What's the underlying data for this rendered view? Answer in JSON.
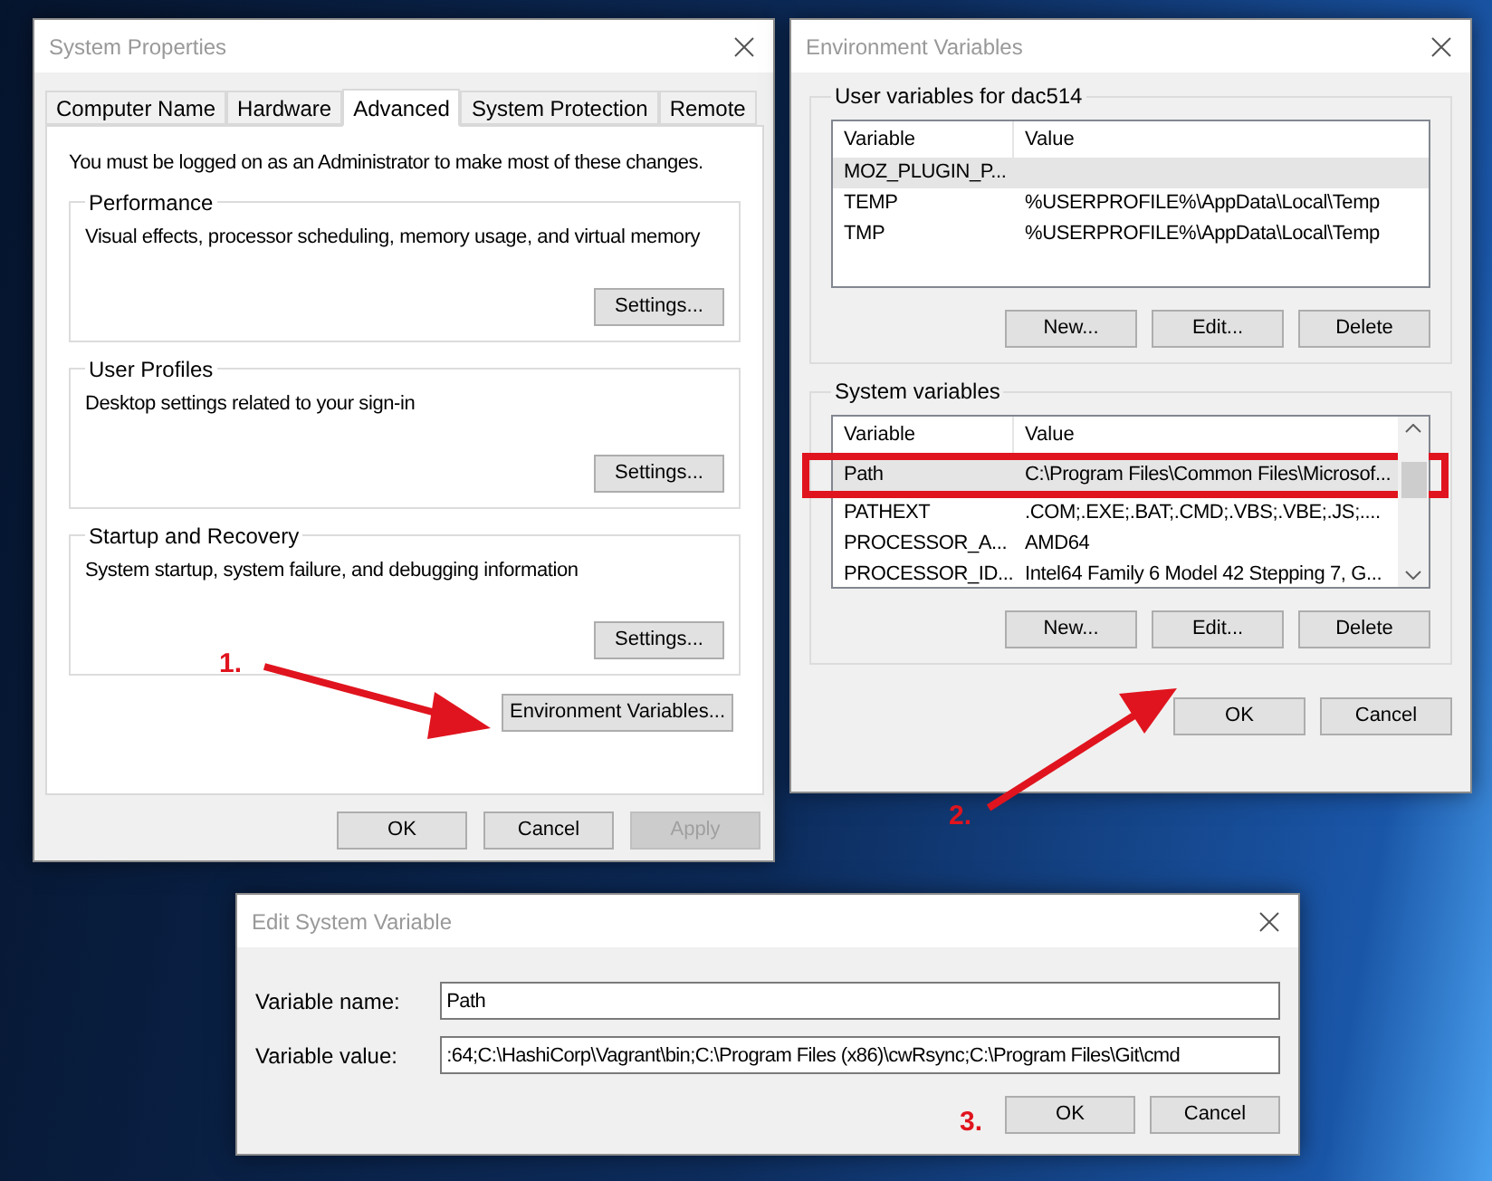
{
  "system_properties": {
    "title": "System Properties",
    "tabs": [
      {
        "label": "Computer Name",
        "selected": false
      },
      {
        "label": "Hardware",
        "selected": false
      },
      {
        "label": "Advanced",
        "selected": true
      },
      {
        "label": "System Protection",
        "selected": false
      },
      {
        "label": "Remote",
        "selected": false
      }
    ],
    "notice": "You must be logged on as an Administrator to make most of these changes.",
    "groups": [
      {
        "title": "Performance",
        "description": "Visual effects, processor scheduling, memory usage, and virtual memory",
        "button": "Settings..."
      },
      {
        "title": "User Profiles",
        "description": "Desktop settings related to your sign-in",
        "button": "Settings..."
      },
      {
        "title": "Startup and Recovery",
        "description": "System startup, system failure, and debugging information",
        "button": "Settings..."
      }
    ],
    "env_button": "Environment Variables...",
    "buttons": [
      {
        "label": "OK",
        "disabled": false
      },
      {
        "label": "Cancel",
        "disabled": false
      },
      {
        "label": "Apply",
        "disabled": true
      }
    ]
  },
  "environment_variables": {
    "title": "Environment Variables",
    "sections": [
      {
        "title": "User variables for dac514",
        "columns": [
          "Variable",
          "Value"
        ],
        "rows": [
          {
            "variable": "MOZ_PLUGIN_P...",
            "value": "",
            "selected": true,
            "highlighted": false
          },
          {
            "variable": "TEMP",
            "value": "%USERPROFILE%\\AppData\\Local\\Temp",
            "selected": false,
            "highlighted": false
          },
          {
            "variable": "TMP",
            "value": "%USERPROFILE%\\AppData\\Local\\Temp",
            "selected": false,
            "highlighted": false
          }
        ],
        "buttons": [
          "New...",
          "Edit...",
          "Delete"
        ]
      },
      {
        "title": "System variables",
        "columns": [
          "Variable",
          "Value"
        ],
        "rows": [
          {
            "variable": "Path",
            "value": "C:\\Program Files\\Common Files\\Microsof...",
            "selected": true,
            "highlighted": true
          },
          {
            "variable": "PATHEXT",
            "value": ".COM;.EXE;.BAT;.CMD;.VBS;.VBE;.JS;....",
            "selected": false,
            "highlighted": false
          },
          {
            "variable": "PROCESSOR_A...",
            "value": "AMD64",
            "selected": false,
            "highlighted": false
          },
          {
            "variable": "PROCESSOR_ID...",
            "value": "Intel64 Family 6 Model 42 Stepping 7, G...",
            "selected": false,
            "highlighted": false
          }
        ],
        "buttons": [
          "New...",
          "Edit...",
          "Delete"
        ]
      }
    ],
    "buttons": [
      "OK",
      "Cancel"
    ]
  },
  "edit_system_variable": {
    "title": "Edit System Variable",
    "fields": [
      {
        "label": "Variable name:",
        "value": "Path"
      },
      {
        "label": "Variable value:",
        "value": ":64;C:\\HashiCorp\\Vagrant\\bin;C:\\Program Files (x86)\\cwRsync;C:\\Program Files\\Git\\cmd"
      }
    ],
    "buttons": [
      "OK",
      "Cancel"
    ]
  },
  "steps": [
    {
      "label": "1."
    },
    {
      "label": "2."
    },
    {
      "label": "3."
    }
  ]
}
